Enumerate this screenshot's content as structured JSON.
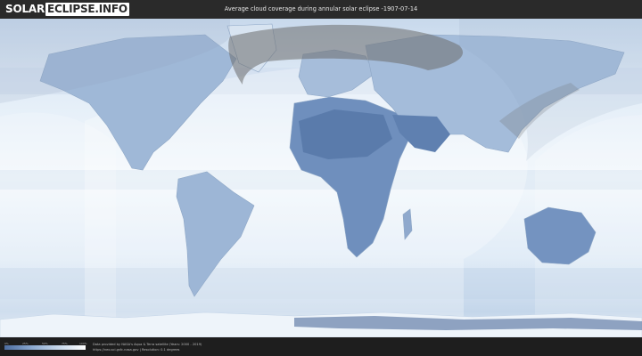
{
  "header": {
    "logo_part1": "SOLAR",
    "logo_part2": "ECLIPSE.INFO",
    "title": "Average cloud coverage during annular solar eclipse -1907-07-14"
  },
  "map": {
    "projection": "equirectangular",
    "colors": {
      "ocean_clear": "#f2f7fc",
      "land_clear": "#5f80b0",
      "cloud_light": "#dbe7f3",
      "path_shadow": "#6c6c6c",
      "coastline": "#9ab0cc"
    },
    "features": [
      "continents",
      "annular-eclipse-path",
      "penumbra-visibility-zone",
      "cloud-bands"
    ]
  },
  "footer": {
    "legend_ticks": [
      "0%",
      "25%",
      "50%",
      "75%",
      "100%"
    ],
    "credit_line1": "Data provided by NASA's Aqua & Terra satellite (Years: 2000 - 2019)",
    "credit_line2": "https://neo.sci.gsfc.nasa.gov | Resolution: 0.1 degrees"
  }
}
